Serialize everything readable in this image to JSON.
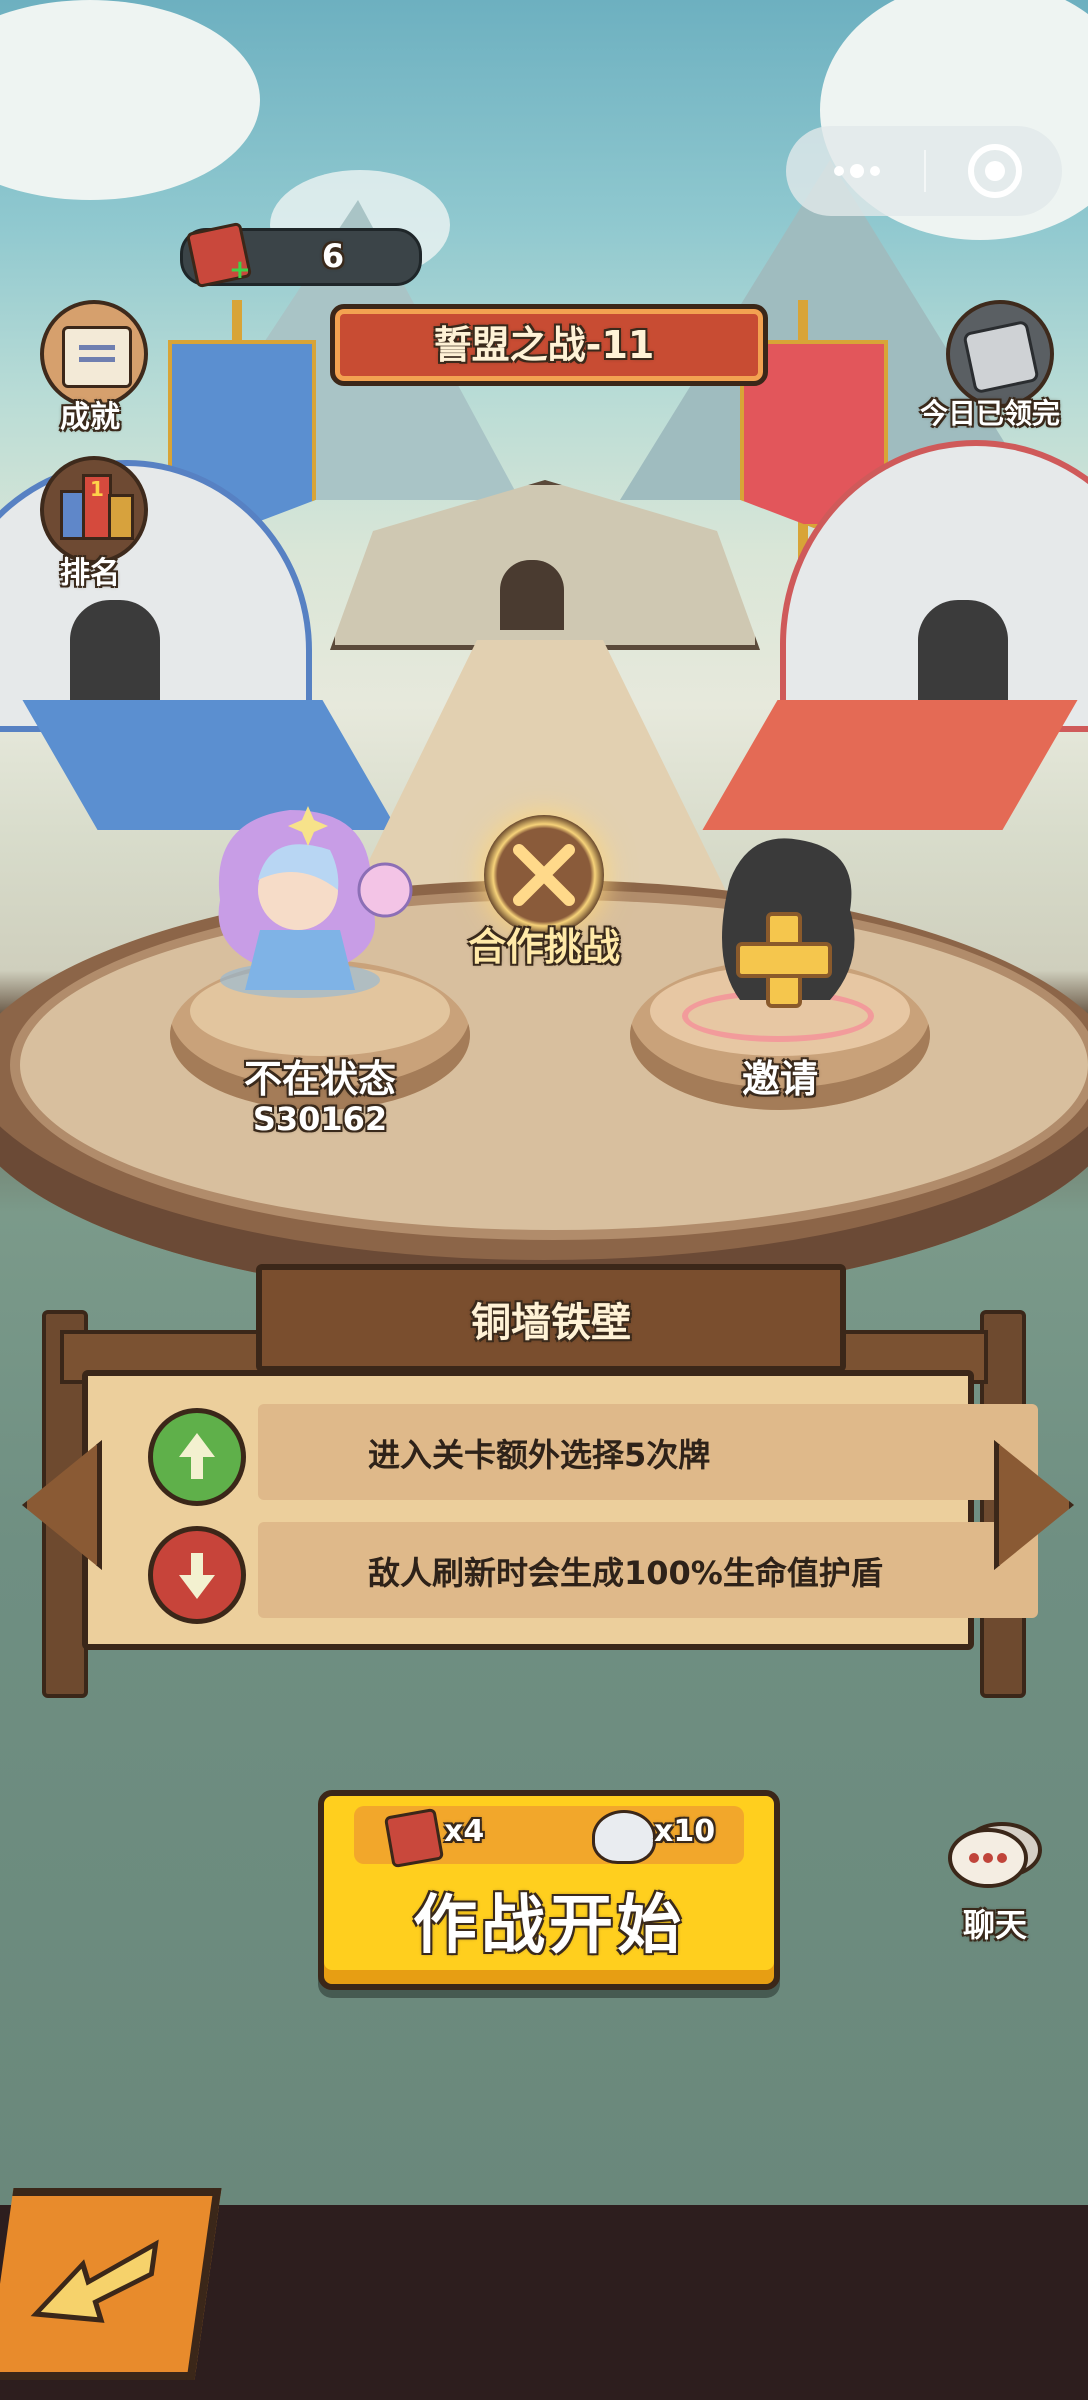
{
  "hud": {
    "ticket_count": "6"
  },
  "header": {
    "title": "誓盟之战-11"
  },
  "left_menu": {
    "achievements_label": "成就",
    "ranking_label": "排名",
    "ranking_badge": "1"
  },
  "right_menu": {
    "daily_reward_label": "今日已领完",
    "chat_label": "聊天"
  },
  "arena": {
    "coop_label": "合作挑战",
    "player": {
      "status": "不在状态",
      "server_id": "S30162"
    },
    "invite_label": "邀请"
  },
  "modifier_panel": {
    "title": "铜墙铁壁",
    "buff_text": "进入关卡额外选择5次牌",
    "debuff_text": "敌人刷新时会生成100%生命值护盾"
  },
  "start_button": {
    "label": "作战开始",
    "cost_ticket": "x4",
    "cost_rice": "x10"
  },
  "colors": {
    "accent_yellow": "#ffcf1e",
    "outline_brown": "#3b2719",
    "bottom_bar": "#2d1e1e"
  }
}
